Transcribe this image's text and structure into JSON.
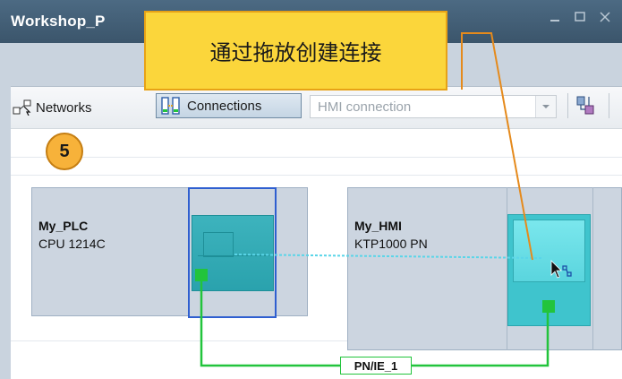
{
  "window": {
    "title": "Workshop_P"
  },
  "callout": {
    "text": "通过拖放创建连接"
  },
  "toolbar": {
    "networks_label": "Networks",
    "connections_label": "Connections",
    "connection_type": "HMI connection"
  },
  "step": {
    "number": "5"
  },
  "devices": {
    "plc": {
      "name": "My_PLC",
      "type": "CPU 1214C"
    },
    "hmi": {
      "name": "My_HMI",
      "type": "KTP1000 PN"
    }
  },
  "network": {
    "label": "PN/IE_1"
  },
  "colors": {
    "callout_fill": "#fbd63b",
    "callout_border": "#e7a216",
    "step_badge": "#f7b23a",
    "network_line": "#22c43c",
    "selection": "#2f5fd0",
    "device_teal": "#2aa2ad",
    "leader_line": "#e58a1c"
  },
  "icons": [
    "networks-icon",
    "connections-icon",
    "chevron-down-icon",
    "network-view-icon",
    "drag-connect-cursor-icon"
  ]
}
